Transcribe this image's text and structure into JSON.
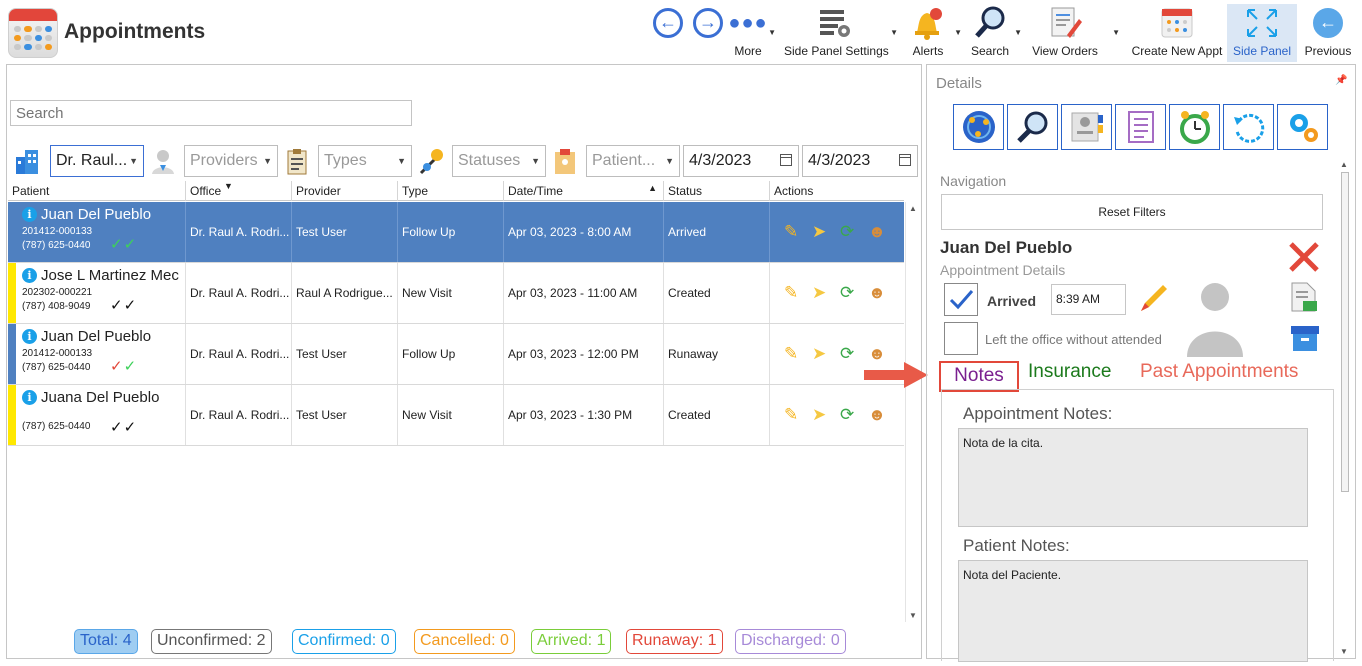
{
  "app": {
    "title": "Appointments"
  },
  "ribbon": {
    "more": "More",
    "side_panel_settings": "Side Panel Settings",
    "alerts": "Alerts",
    "search": "Search",
    "view_orders": "View Orders",
    "create_new_appt": "Create New Appt",
    "side_panel": "Side Panel",
    "previous": "Previous"
  },
  "filters": {
    "search_placeholder": "Search",
    "office": "Dr. Raul...",
    "providers": "Providers",
    "types": "Types",
    "statuses": "Statuses",
    "patient": "Patient...",
    "date_from": "4/3/2023",
    "date_to": "4/3/2023"
  },
  "grid": {
    "headers": [
      "Patient",
      "Office",
      "Provider",
      "Type",
      "Date/Time",
      "Status",
      "Actions"
    ],
    "rows": [
      {
        "name": "Juan Del Pueblo",
        "id": "201412-000133",
        "phone": "(787) 625-0440",
        "office": "Dr. Raul A. Rodri...",
        "provider": "Test User",
        "type": "Follow Up",
        "datetime": "Apr 03, 2023 - 8:00 AM",
        "status": "Arrived",
        "checks": "✓✓"
      },
      {
        "name": "Jose L Martinez Mec",
        "id": "202302-000221",
        "phone": "(787) 408-9049",
        "office": "Dr. Raul A. Rodri...",
        "provider": "Raul A Rodrigue...",
        "type": "New Visit",
        "datetime": "Apr 03, 2023 - 11:00 AM",
        "status": "Created",
        "checks": "✓✓"
      },
      {
        "name": "Juan Del Pueblo",
        "id": "201412-000133",
        "phone": "(787) 625-0440",
        "office": "Dr. Raul A. Rodri...",
        "provider": "Test User",
        "type": "Follow Up",
        "datetime": "Apr 03, 2023 - 12:00 PM",
        "status": "Runaway",
        "checks": "✓✓"
      },
      {
        "name": "Juana Del Pueblo",
        "id": "",
        "phone": "(787) 625-0440",
        "office": "Dr. Raul A. Rodri...",
        "provider": "Test User",
        "type": "New Visit",
        "datetime": "Apr 03, 2023 - 1:30 PM",
        "status": "Created",
        "checks": "✓✓"
      }
    ]
  },
  "status_bar": {
    "total": "Total: 4",
    "unconfirmed": "Unconfirmed: 2",
    "confirmed": "Confirmed: 0",
    "cancelled": "Cancelled: 0",
    "arrived": "Arrived: 1",
    "runaway": "Runaway: 1",
    "discharged": "Discharged: 0"
  },
  "details": {
    "title": "Details",
    "navigation_label": "Navigation",
    "reset_filters": "Reset Filters",
    "patient_name": "Juan Del Pueblo",
    "subtitle": "Appointment Details",
    "arrived_label": "Arrived",
    "arrived_time": "8:39 AM",
    "left_office_label": "Left the office without attended",
    "tabs": {
      "notes": "Notes",
      "insurance": "Insurance",
      "past": "Past Appointments"
    },
    "appointment_notes_label": "Appointment Notes:",
    "appointment_notes": "Nota de la cita.",
    "patient_notes_label": "Patient Notes:",
    "patient_notes": "Nota del Paciente."
  },
  "colors": {
    "selection": "#4f80c0",
    "accent_blue": "#2a63c9",
    "highlight_red": "#e2483a",
    "row_bar_yellow": "#ffe800",
    "row_bar_blue": "#4f80c0"
  }
}
